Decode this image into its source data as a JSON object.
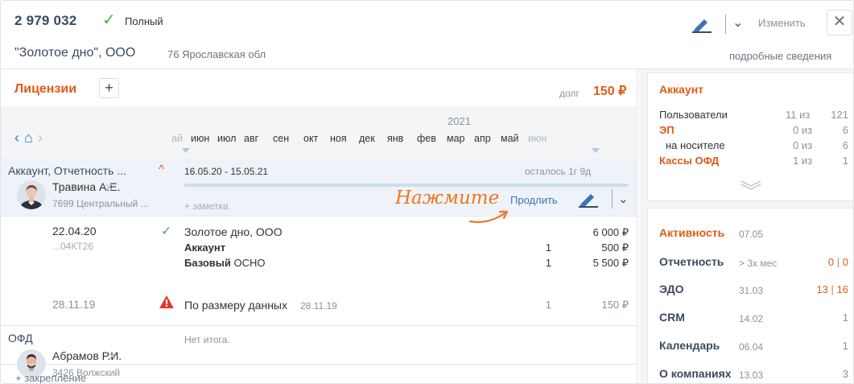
{
  "header": {
    "license_number": "2 979 032",
    "status": "Полный",
    "company_name": "\"Золотое дно\", ООО",
    "region": "76 Ярославская обл",
    "change_label": "Изменить",
    "details_link": "подробные сведения"
  },
  "licenses": {
    "title": "Лицензии",
    "debt_label": "долг",
    "debt_value": "150 ₽"
  },
  "timeline": {
    "year": "2021",
    "months": [
      "ай",
      "июн",
      "июл",
      "авг",
      "сен",
      "окт",
      "ноя",
      "дек",
      "янв",
      "фев",
      "мар",
      "апр",
      "май",
      "июн"
    ]
  },
  "account_row": {
    "title": "Аккаунт, Отчетность ...",
    "period": "16.05.20 - 15.05.21",
    "remaining": "осталось 1г 9д",
    "person": "Травина А.Е.",
    "branch": "7699 Центральный ...",
    "note": "+ заметка",
    "hint": "Нажмите",
    "renew": "Продлить"
  },
  "doc1": {
    "date": "22.04.20",
    "code": "...04КТ26",
    "name": "Золотое дно, ООО",
    "total": "6 000 ₽",
    "items": [
      {
        "name": "Аккаунт",
        "suffix": "",
        "qty": "1",
        "amount": "500 ₽"
      },
      {
        "name": "Базовый",
        "suffix": " ОСНО",
        "qty": "1",
        "amount": "5 500 ₽"
      }
    ]
  },
  "doc2": {
    "date": "28.11.19",
    "name": "По размеру данных",
    "date_inline": "28.11.19",
    "qty": "1",
    "amount": "150 ₽"
  },
  "ofd_row": {
    "title": "ОФД",
    "total_text": "Нет итога.",
    "person": "Абрамов Р.И.",
    "branch": "3426 Волжский"
  },
  "add_binding": "+ закрепление",
  "account_card": {
    "title": "Аккаунт",
    "rows": [
      {
        "label": "Пользователи",
        "used": "11 из",
        "total": "121"
      },
      {
        "label": "ЭП",
        "used": "0 из",
        "total": "6"
      },
      {
        "label": "на носителе",
        "used": "0 из",
        "total": "6"
      },
      {
        "label": "Кассы ОФД",
        "used": "1 из",
        "total": "1"
      }
    ]
  },
  "activity_card": {
    "rows": [
      {
        "label": "Активность",
        "date": "07.05",
        "value": ""
      },
      {
        "label": "Отчетность",
        "date": "> 3х мес",
        "value_a": "0",
        "value_b": "0"
      },
      {
        "label": "ЭДО",
        "date": "31.03",
        "value_a": "13",
        "value_b": "16"
      },
      {
        "label": "CRM",
        "date": "14.02",
        "value": "1"
      },
      {
        "label": "Календарь",
        "date": "06.04",
        "value": "1"
      },
      {
        "label": "О компаниях",
        "date": "13.03",
        "value": "3"
      }
    ]
  },
  "colors": {
    "accent": "#e05a18",
    "link": "#3a75b5",
    "ok": "#4cae4f",
    "hint": "#f4731f"
  }
}
